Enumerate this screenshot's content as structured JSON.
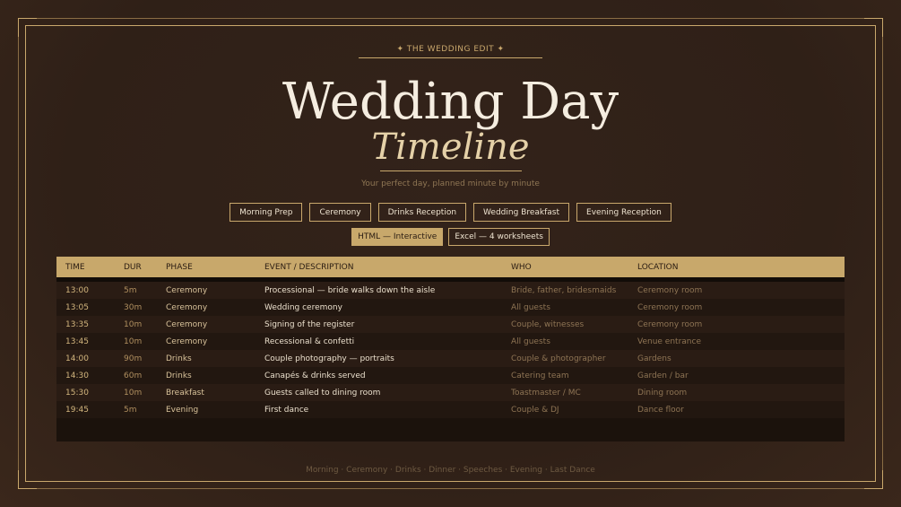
{
  "eyebrow": "✦  THE WEDDING EDIT  ✦",
  "title": "Wedding Day",
  "subtitle": "Timeline",
  "tagline": "Your perfect day, planned minute by minute",
  "nav": [
    "Morning Prep",
    "Ceremony",
    "Drinks Reception",
    "Wedding Breakfast",
    "Evening Reception"
  ],
  "modes": [
    {
      "label": "HTML — Interactive",
      "active": true
    },
    {
      "label": "Excel — 4 worksheets",
      "active": false
    }
  ],
  "table": {
    "headers": {
      "time": "TIME",
      "dur": "DUR",
      "phase": "PHASE",
      "event": "EVENT / DESCRIPTION",
      "who": "WHO",
      "location": "LOCATION"
    },
    "rows": [
      {
        "time": "13:00",
        "dur": "5m",
        "phase": "Ceremony",
        "event": "Processional — bride walks down the aisle",
        "who": "Bride, father, bridesmaids",
        "location": "Ceremony room"
      },
      {
        "time": "13:05",
        "dur": "30m",
        "phase": "Ceremony",
        "event": "Wedding ceremony",
        "who": "All guests",
        "location": "Ceremony room"
      },
      {
        "time": "13:35",
        "dur": "10m",
        "phase": "Ceremony",
        "event": "Signing of the register",
        "who": "Couple, witnesses",
        "location": "Ceremony room"
      },
      {
        "time": "13:45",
        "dur": "10m",
        "phase": "Ceremony",
        "event": "Recessional & confetti",
        "who": "All guests",
        "location": "Venue entrance"
      },
      {
        "time": "14:00",
        "dur": "90m",
        "phase": "Drinks",
        "event": "Couple photography — portraits",
        "who": "Couple & photographer",
        "location": "Gardens"
      },
      {
        "time": "14:30",
        "dur": "60m",
        "phase": "Drinks",
        "event": "Canapés & drinks served",
        "who": "Catering team",
        "location": "Garden / bar"
      },
      {
        "time": "15:30",
        "dur": "10m",
        "phase": "Breakfast",
        "event": "Guests called to dining room",
        "who": "Toastmaster / MC",
        "location": "Dining room"
      },
      {
        "time": "19:45",
        "dur": "5m",
        "phase": "Evening",
        "event": "First dance",
        "who": "Couple & DJ",
        "location": "Dance floor"
      }
    ]
  },
  "footer": "Morning · Ceremony · Drinks · Dinner · Speeches · Evening · Last Dance",
  "colors": {
    "gold": "#c8a86b",
    "background": "#2f2017",
    "text": "#f5ede0"
  }
}
